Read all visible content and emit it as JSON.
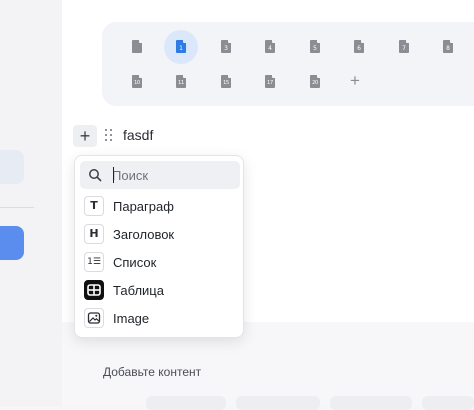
{
  "top_text": "",
  "file_icons": [
    {
      "name": "file-icon",
      "glyph": "",
      "selected": false
    },
    {
      "name": "file-1-icon",
      "glyph": "1",
      "selected": true
    },
    {
      "name": "file-3-icon",
      "glyph": "3",
      "selected": false
    },
    {
      "name": "file-4-icon",
      "glyph": "4",
      "selected": false
    },
    {
      "name": "file-5-icon",
      "glyph": "5",
      "selected": false
    },
    {
      "name": "file-6-icon",
      "glyph": "6",
      "selected": false
    },
    {
      "name": "file-7-icon",
      "glyph": "7",
      "selected": false
    },
    {
      "name": "file-8-icon",
      "glyph": "8",
      "selected": false
    },
    {
      "name": "file-10-icon",
      "glyph": "10",
      "selected": false
    },
    {
      "name": "file-11-icon",
      "glyph": "11",
      "selected": false
    },
    {
      "name": "file-15-icon",
      "glyph": "15",
      "selected": false
    },
    {
      "name": "file-17-icon",
      "glyph": "17",
      "selected": false
    },
    {
      "name": "file-20-icon",
      "glyph": "20",
      "selected": false
    }
  ],
  "colors": {
    "accent": "#2f7be6",
    "left_blue": "#5b8def"
  },
  "block": {
    "add_icon": "plus-icon",
    "handle_icon": "drag-handle-icon",
    "text": "fasdf"
  },
  "menu": {
    "search_placeholder": "Поиск",
    "items": [
      {
        "icon": "T",
        "label": "Параграф"
      },
      {
        "icon": "H",
        "label": "Заголовок"
      },
      {
        "icon": "1☰",
        "label": "Список"
      },
      {
        "icon": "table-icon",
        "label": "Таблица"
      },
      {
        "icon": "image-icon",
        "label": "Image"
      }
    ]
  },
  "lower": {
    "hint": "Добавьте контент"
  }
}
